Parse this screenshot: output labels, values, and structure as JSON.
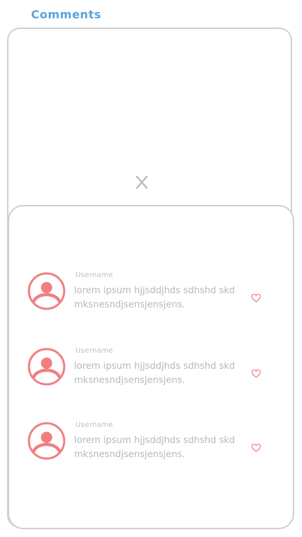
{
  "header": {
    "title": "Comments"
  },
  "overlay": {
    "close_icon": "close-icon"
  },
  "comments": [
    {
      "username": "Username",
      "text": "lorem ipsum hjjsddjhds sdhshd skdmksnesndjsensjensjens.",
      "avatar_icon": "user-avatar-icon",
      "like_icon": "heart-icon"
    },
    {
      "username": "Username",
      "text": "lorem ipsum hjjsddjhds sdhshd skdmksnesndjsensjensjens.",
      "avatar_icon": "user-avatar-icon",
      "like_icon": "heart-icon"
    },
    {
      "username": "Username",
      "text": "lorem ipsum hjjsddjhds sdhshd skdmksnesndjsensjensjens.",
      "avatar_icon": "user-avatar-icon",
      "like_icon": "heart-icon"
    }
  ],
  "colors": {
    "title": "#5aa4dc",
    "accent": "#f08080",
    "border": "#cfcfcf",
    "muted_text": "#b8b8b8"
  }
}
